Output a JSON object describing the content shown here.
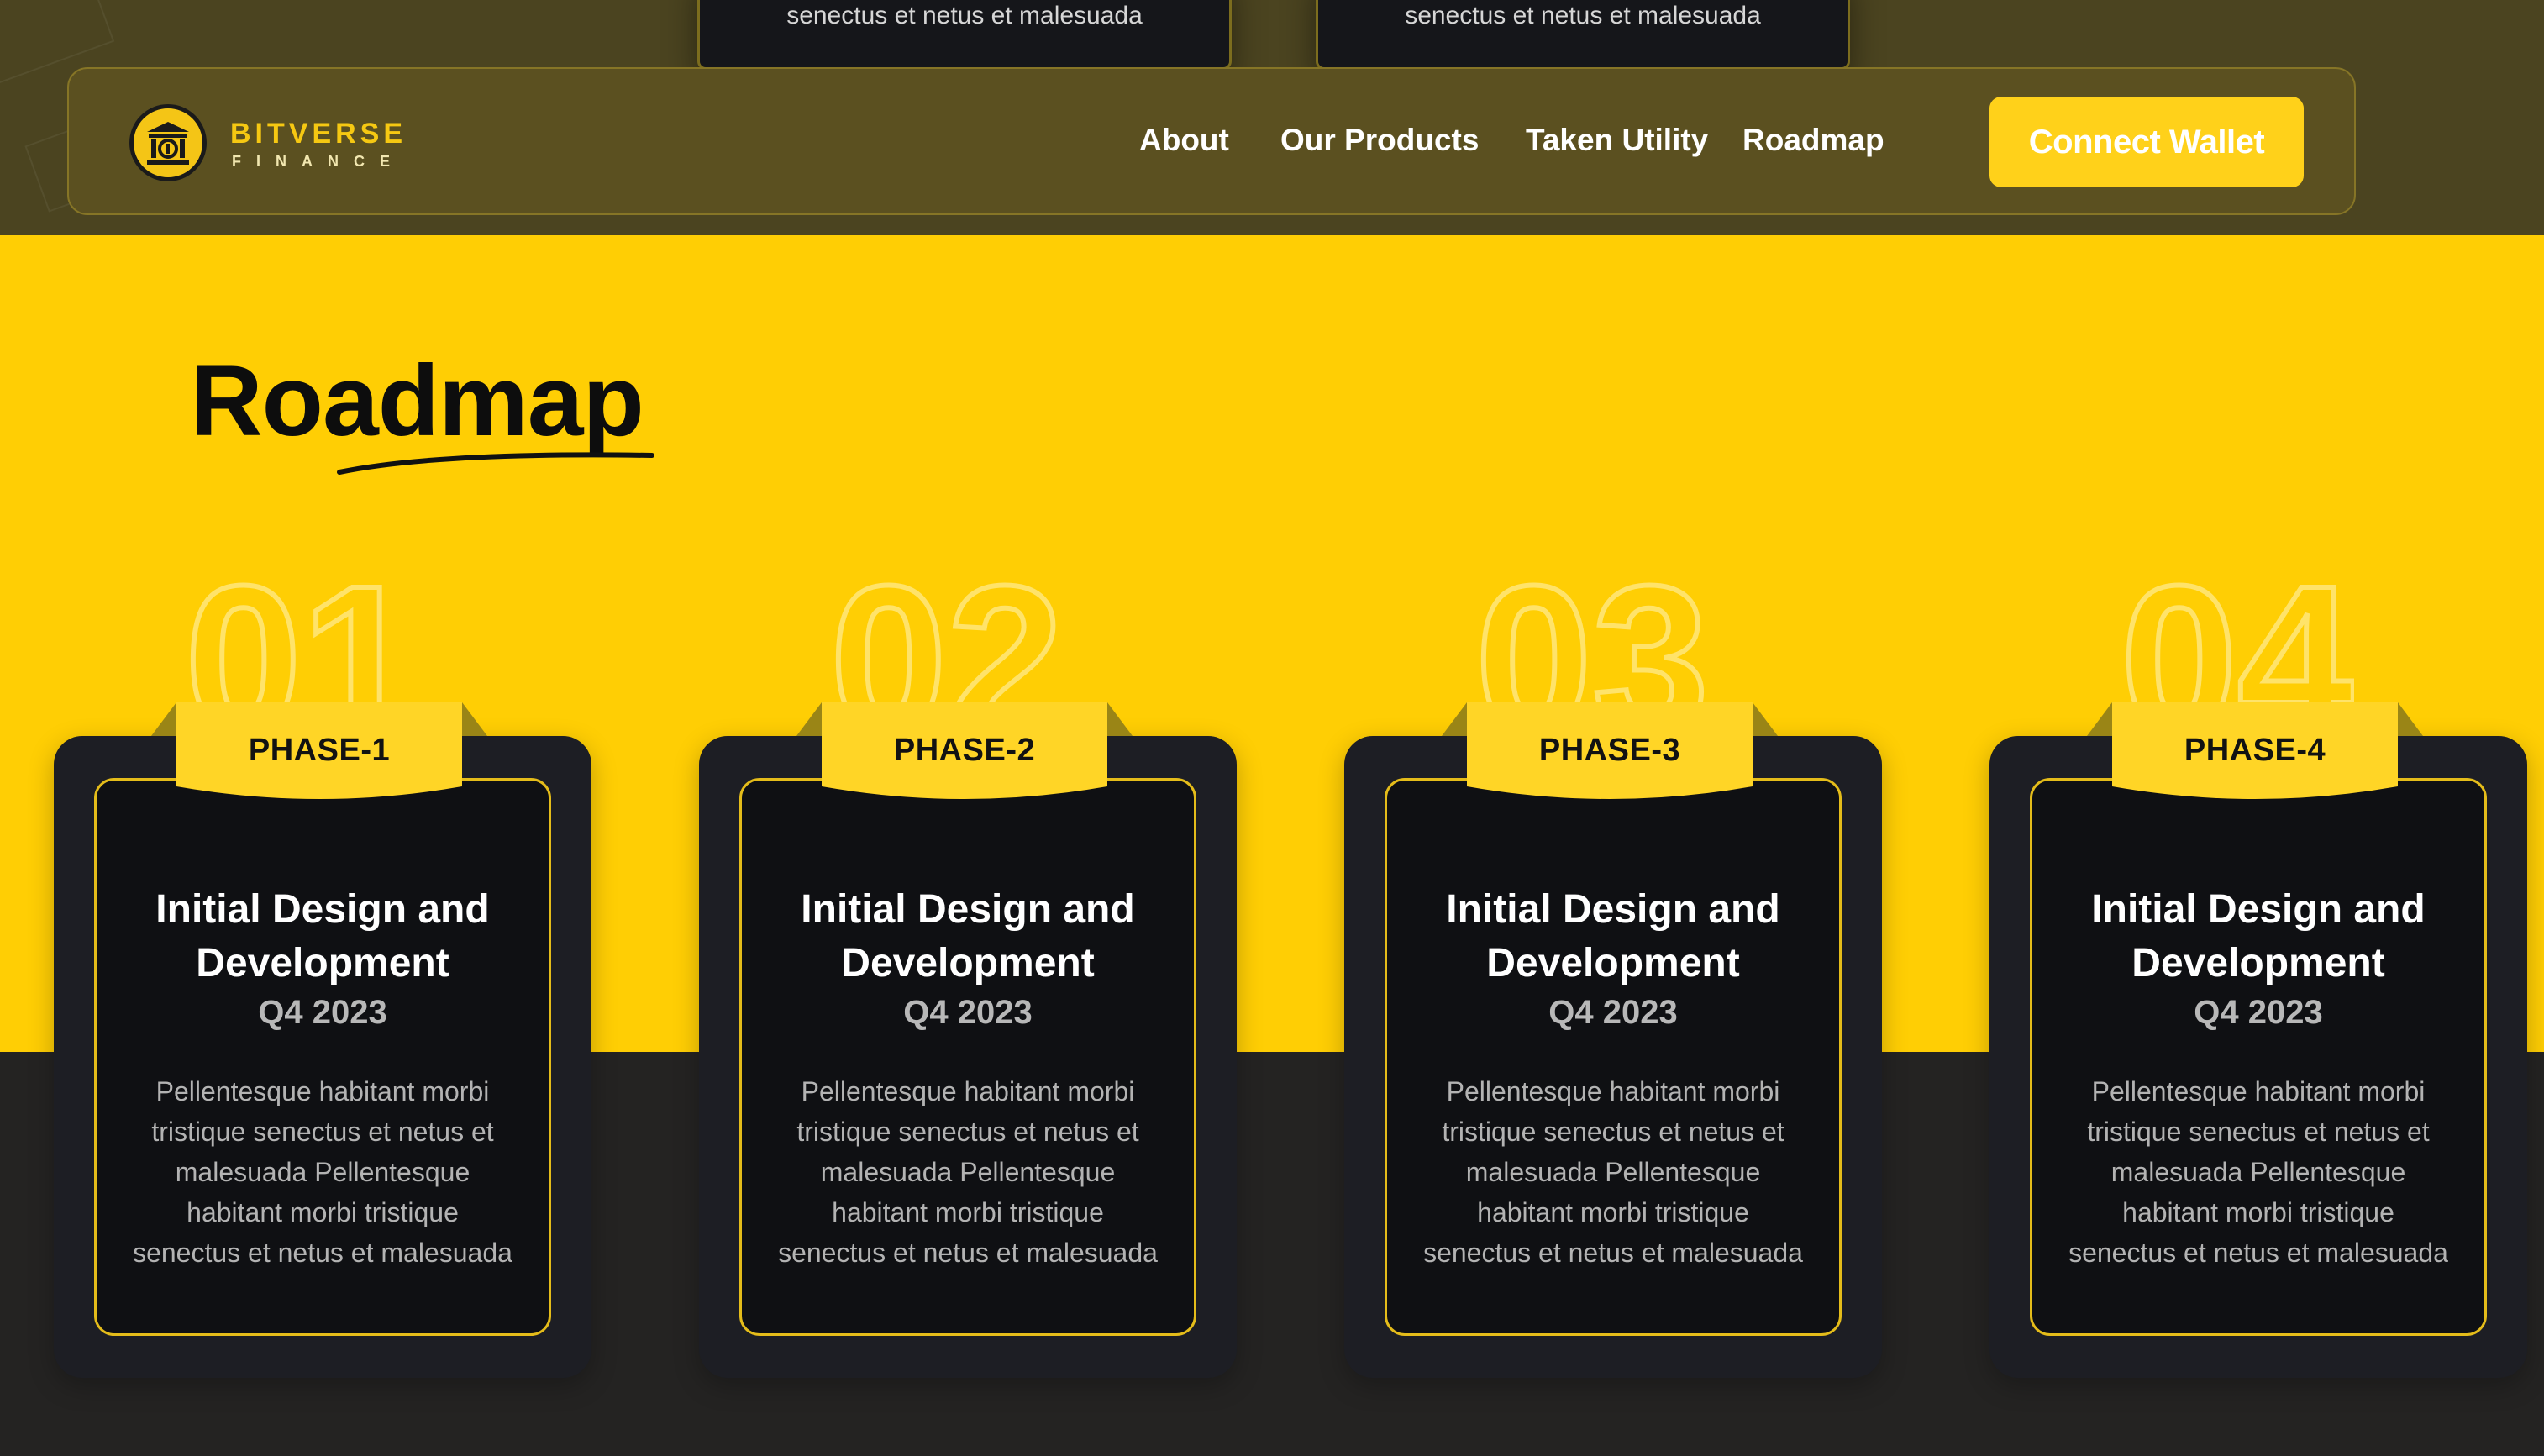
{
  "prev_cards": [
    {
      "text": "senectus et netus et malesuada"
    },
    {
      "text": "senectus et netus et malesuada"
    }
  ],
  "brand": {
    "name": "BITVERSE",
    "sub": "FINANCE",
    "logo_icon": "bank-building-icon",
    "accent": "#ffce04"
  },
  "nav": {
    "links": [
      "About",
      "Our Products",
      "Taken Utility",
      "Roadmap"
    ],
    "connect_label": "Connect Wallet"
  },
  "roadmap": {
    "title": "Roadmap",
    "numbers": [
      "01",
      "02",
      "03",
      "04"
    ],
    "phases": [
      {
        "label": "PHASE-1",
        "title": "Initial Design and Development",
        "date": "Q4 2023",
        "desc": "Pellentesque habitant morbi tristique senectus et netus et malesuada Pellentesque habitant morbi tristique senectus et netus et malesuada"
      },
      {
        "label": "PHASE-2",
        "title": "Initial Design and Development",
        "date": "Q4 2023",
        "desc": "Pellentesque habitant morbi tristique senectus et netus et malesuada Pellentesque habitant morbi tristique senectus et netus et malesuada"
      },
      {
        "label": "PHASE-3",
        "title": "Initial Design and Development",
        "date": "Q4 2023",
        "desc": "Pellentesque habitant morbi tristique senectus et netus et malesuada Pellentesque habitant morbi tristique senectus et netus et malesuada"
      },
      {
        "label": "PHASE-4",
        "title": "Initial Design and Development",
        "date": "Q4 2023",
        "desc": "Pellentesque habitant morbi tristique senectus et netus et malesuada Pellentesque habitant morbi tristique senectus et netus et malesuada"
      }
    ]
  }
}
